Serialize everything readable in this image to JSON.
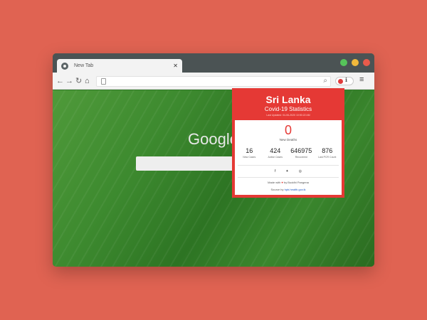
{
  "browser": {
    "tab_title": "New Tab",
    "tab_close": "✕",
    "nav": {
      "back": "←",
      "forward": "→",
      "reload": "↻",
      "home": "⌂"
    },
    "omnibox_search_icon": "⌕",
    "menu_icon": "≡",
    "extension_icon": "ℹ",
    "colors": {
      "titlebar": "#4b5354",
      "toolbar": "#f3f3f3"
    }
  },
  "newtab": {
    "logo_text": "Google"
  },
  "popup": {
    "title": "Sri Lanka",
    "subtitle": "Covid-19 Statistics",
    "last_updated": "Last Updated: 04-06-2020 10:50:22 AM",
    "deaths": {
      "value": "0",
      "label": "New Deaths"
    },
    "stats": [
      {
        "value": "16",
        "label": "New Cases"
      },
      {
        "value": "424",
        "label": "Active Cases"
      },
      {
        "value": "646975",
        "label": "Recovered"
      },
      {
        "value": "876",
        "label": "Last PCR Count"
      }
    ],
    "social": {
      "facebook": "f",
      "twitter": "✦",
      "github": "◎"
    },
    "credit_prefix": "Made with",
    "credit_heart": "♥",
    "credit_author": "by Buddhi Pangena",
    "source_prefix": "Source by",
    "source_link": "hpb.health.gov.lk",
    "colors": {
      "accent": "#e53935"
    }
  }
}
